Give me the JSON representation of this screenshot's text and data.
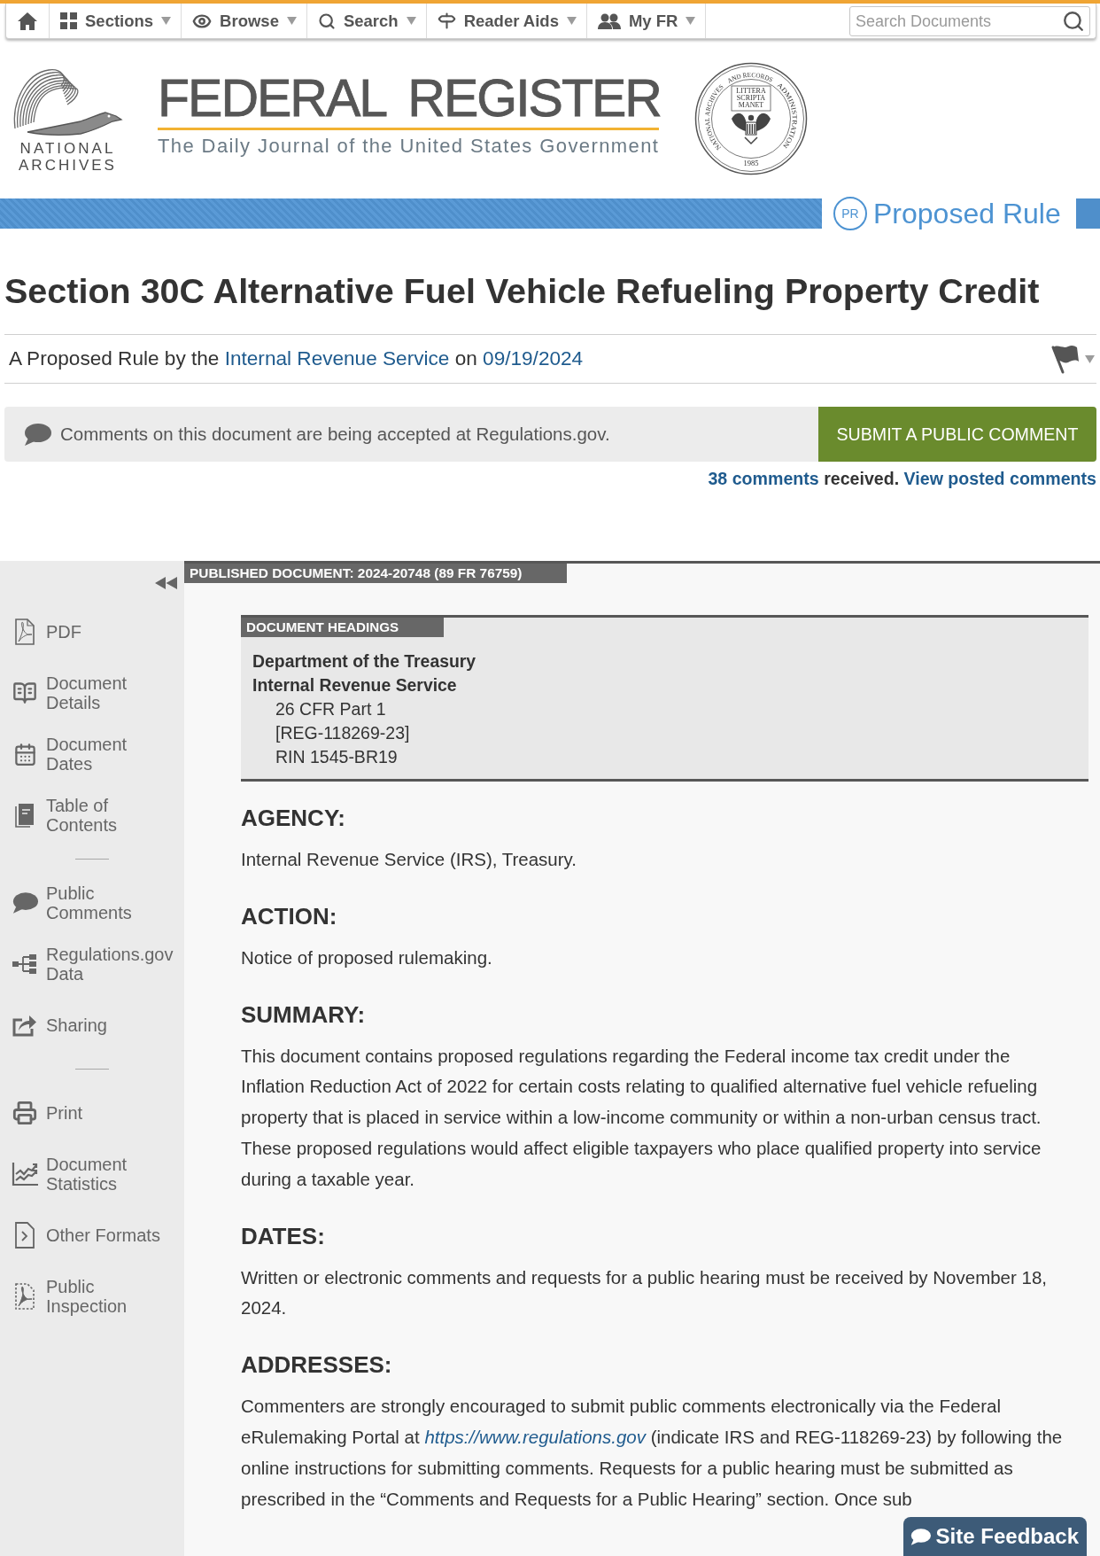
{
  "nav": {
    "items": [
      {
        "label": "Sections"
      },
      {
        "label": "Browse"
      },
      {
        "label": "Search"
      },
      {
        "label": "Reader Aids"
      },
      {
        "label": "My FR"
      }
    ],
    "search": {
      "placeholder": "Search Documents"
    }
  },
  "masthead": {
    "logo_text": [
      "NATIONAL",
      "ARCHIVES"
    ],
    "title": "FEDERAL REGISTER",
    "tagline": "The Daily Journal of the United States Government",
    "seal": {
      "ring_text": [
        "NATIONAL ARCHIVES",
        "AND RECORDS",
        "ADMINISTRATION"
      ],
      "motto": [
        "LITTERA",
        "SCRIPTA",
        "MANET"
      ],
      "year": "1985"
    }
  },
  "document_type": {
    "badge": "PR",
    "label": "Proposed Rule"
  },
  "document": {
    "title": "Section 30C Alternative Fuel Vehicle Refueling Property Credit",
    "byline": [
      {
        "kind": "text",
        "text": "A Proposed Rule by the"
      },
      {
        "kind": "link",
        "text": "Internal Revenue Service"
      },
      {
        "kind": "text",
        "text": "on"
      },
      {
        "kind": "link",
        "text": "09/19/2024"
      }
    ]
  },
  "comments": {
    "notice": "Comments on this document are being accepted at Regulations.gov.",
    "button": "SUBMIT A PUBLIC COMMENT",
    "count": [
      {
        "kind": "link",
        "text": "38 comments"
      },
      {
        "kind": "text",
        "text": "received."
      },
      {
        "kind": "link",
        "text": "View posted comments"
      }
    ]
  },
  "sidebar": {
    "groups": [
      {
        "items": [
          {
            "label": "PDF"
          },
          {
            "label": "Document Details"
          },
          {
            "label": "Document Dates"
          },
          {
            "label": "Table of Contents"
          }
        ]
      },
      {
        "items": [
          {
            "label": "Public Comments"
          },
          {
            "label": "Regulations.gov Data"
          },
          {
            "label": "Sharing"
          }
        ]
      },
      {
        "items": [
          {
            "label": "Print"
          },
          {
            "label": "Document Statistics"
          },
          {
            "label": "Other Formats"
          },
          {
            "label": "Public Inspection"
          }
        ]
      }
    ]
  },
  "published_label": "PUBLISHED DOCUMENT: 2024-20748 (89 FR 76759)",
  "document_headings": {
    "label": "DOCUMENT HEADINGS",
    "agencies": [
      "Department of the Treasury",
      "Internal Revenue Service"
    ],
    "details": [
      "26 CFR Part 1",
      "[REG-118269-23]",
      "RIN 1545-BR19"
    ]
  },
  "sections": [
    {
      "heading": "AGENCY:",
      "paragraph": [
        {
          "kind": "text",
          "text": "Internal Revenue Service (IRS), Treasury."
        }
      ]
    },
    {
      "heading": "ACTION:",
      "paragraph": [
        {
          "kind": "text",
          "text": "Notice of proposed rulemaking."
        }
      ]
    },
    {
      "heading": "SUMMARY:",
      "paragraph": [
        {
          "kind": "text",
          "text": "This document contains proposed regulations regarding the Federal income tax credit under the Inflation Reduction Act of 2022 for certain costs relating to qualified alternative fuel vehicle refueling property that is placed in service within a low-income community or within a non-urban census tract. These proposed regulations would affect eligible taxpayers who place qualified property into service during a taxable year."
        }
      ]
    },
    {
      "heading": "DATES:",
      "paragraph": [
        {
          "kind": "text",
          "text": "Written or electronic comments and requests for a public hearing must be received by November 18, 2024."
        }
      ]
    },
    {
      "heading": "ADDRESSES:",
      "paragraph": [
        {
          "kind": "text",
          "text": "Commenters are strongly encouraged to submit public comments electronically via the Federal eRulemaking Portal at"
        },
        {
          "kind": "link",
          "text": "https://www.regulations.gov"
        },
        {
          "kind": "text",
          "text": "(indicate IRS and REG-118269-23) by following the online instructions for submitting comments. Requests for a public hearing must be submitted as prescribed in the “Comments and Requests for a Public Hearing” section. Once sub"
        }
      ]
    }
  ],
  "site_feedback": {
    "label": "Site Feedback"
  }
}
